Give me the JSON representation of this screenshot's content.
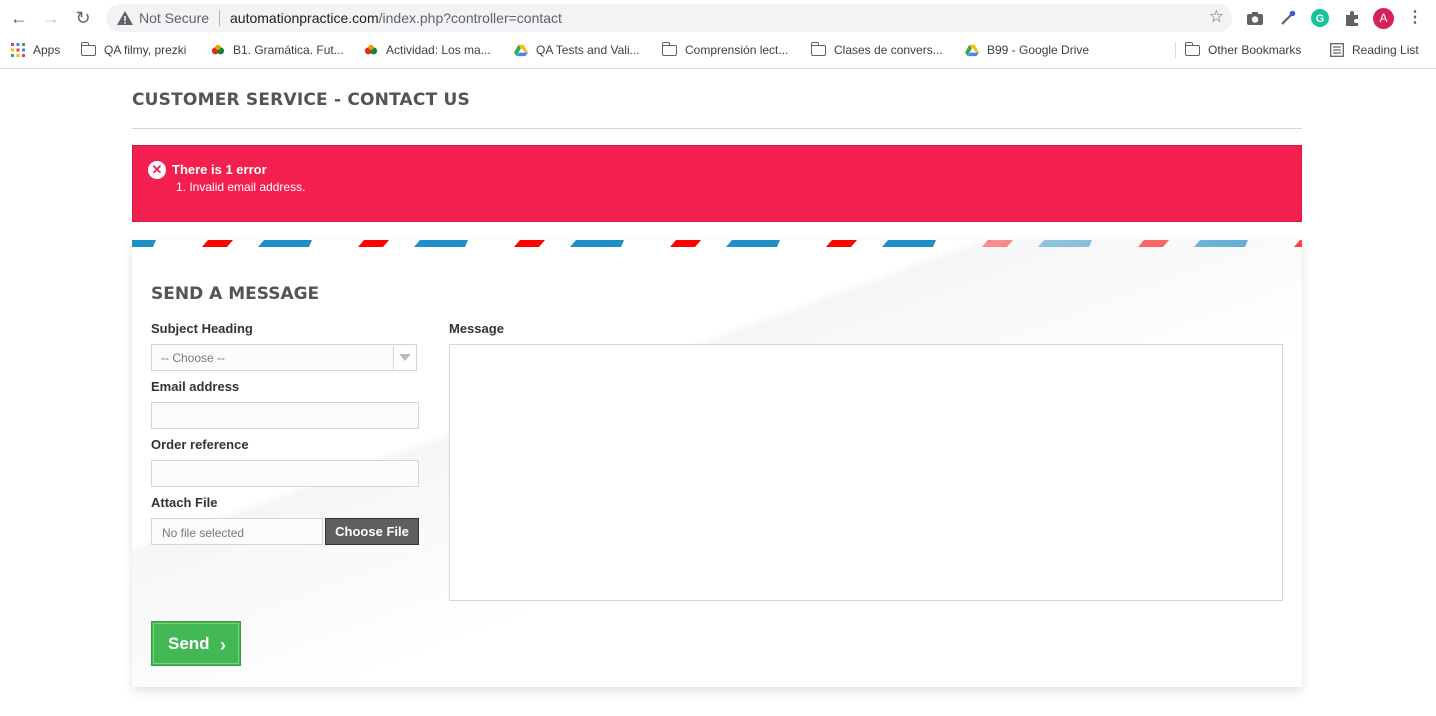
{
  "browser": {
    "security_label": "Not Secure",
    "url_host": "automationpractice.com",
    "url_path": "/index.php?controller=contact",
    "profile_initial": "A",
    "bookmarks": [
      {
        "label": "Apps",
        "icon": "apps-grid-icon"
      },
      {
        "label": "QA filmy, prezki",
        "icon": "folder-icon"
      },
      {
        "label": "B1. Gramática. Fut...",
        "icon": "site-favicon"
      },
      {
        "label": "Actividad: Los ma...",
        "icon": "site-favicon"
      },
      {
        "label": "QA Tests and Vali...",
        "icon": "google-drive-icon"
      },
      {
        "label": "Comprensión lect...",
        "icon": "folder-icon"
      },
      {
        "label": "Clases de convers...",
        "icon": "folder-icon"
      },
      {
        "label": "B99 - Google Drive",
        "icon": "google-drive-icon"
      }
    ],
    "other_bookmarks": "Other Bookmarks",
    "reading_list": "Reading List"
  },
  "page": {
    "heading": "CUSTOMER SERVICE - CONTACT US",
    "alert": {
      "title": "There is 1 error",
      "message": "1. Invalid email address.",
      "color": "#f3204f"
    },
    "form": {
      "title": "SEND A MESSAGE",
      "subject_label": "Subject Heading",
      "subject_value": "-- Choose --",
      "email_label": "Email address",
      "email_value": "",
      "order_label": "Order reference",
      "order_value": "",
      "attach_label": "Attach File",
      "file_placeholder": "No file selected",
      "choose_file": "Choose File",
      "message_label": "Message",
      "message_value": "",
      "send_label": "Send"
    }
  }
}
